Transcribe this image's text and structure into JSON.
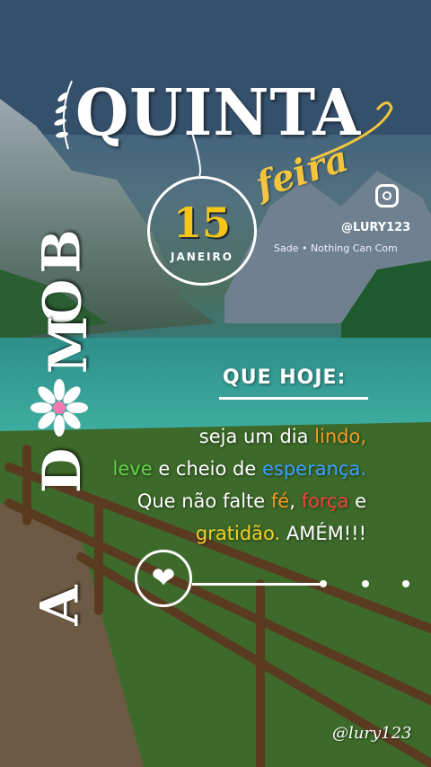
{
  "header": {
    "title": "QUINTA",
    "script_word": "feira"
  },
  "date": {
    "day": "15",
    "month": "JANEIRO"
  },
  "greeting_letters": [
    "B",
    "O",
    "M",
    "D",
    "A"
  ],
  "social": {
    "icon": "instagram-icon",
    "handle": "@LURY123",
    "music_ticker": "Sade • Nothing Can Come Be"
  },
  "message": {
    "heading": "QUE HOJE:",
    "line1_a": "seja um dia ",
    "line1_b": "lindo,",
    "line2_a": "leve",
    "line2_b": " e cheio de ",
    "line2_c": "esperança.",
    "line3_a": "Que não falte ",
    "line3_b": "fé",
    "line3_c": ", ",
    "line3_d": "força",
    "line3_e": " e",
    "line4_a": "gratidão.",
    "line4_b": " AMÉM!!!"
  },
  "player": {
    "icon": "heart-icon"
  },
  "watermark": "@lury123",
  "colors": {
    "orange": "#f79a1f",
    "green": "#64d24a",
    "blue": "#3aa0ff",
    "red": "#f0443a",
    "yellow": "#f3d12a",
    "gold": "#f5c518"
  }
}
